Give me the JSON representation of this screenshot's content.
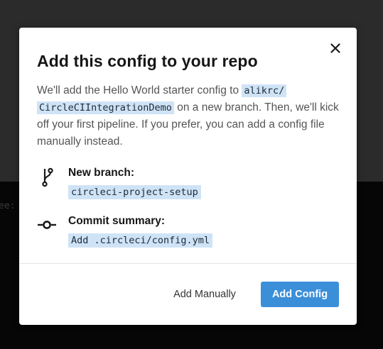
{
  "backdrop": {
    "text": "ee:"
  },
  "modal": {
    "title": "Add this config to your repo",
    "description": {
      "part1": "We'll add the Hello World starter config to ",
      "repo_line1": "alikrc/",
      "repo_line2": "CircleCIIntegrationDemo",
      "part2": " on a new branch. Then, we'll kick off your first pipeline. If you prefer, you can add a config file manually instead."
    },
    "branch": {
      "label": "New branch:",
      "value": "circleci-project-setup",
      "icon": "git-branch-icon"
    },
    "commit": {
      "label": "Commit summary:",
      "value": "Add .circleci/config.yml",
      "icon": "git-commit-icon"
    },
    "buttons": {
      "secondary": "Add Manually",
      "primary": "Add Config"
    },
    "colors": {
      "accent": "#3b8fd9",
      "code_bg": "#cfe3f6"
    }
  }
}
